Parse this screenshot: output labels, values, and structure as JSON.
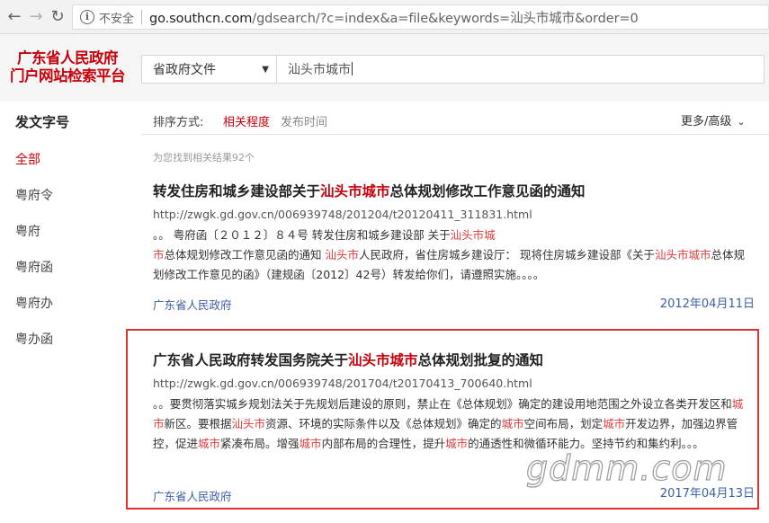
{
  "browser": {
    "security_label": "不安全",
    "url_host": "go.southcn.com",
    "url_rest": "/gdsearch/?c=index&a=file&keywords=汕头市城市&order=0"
  },
  "logo": {
    "line1": "广东省人民政府",
    "line2": "门户网站检索平台"
  },
  "search": {
    "scope": "省政府文件",
    "keyword": "汕头市城市"
  },
  "sidebar": {
    "title": "发文字号",
    "items": [
      {
        "label": "全部",
        "active": true
      },
      {
        "label": "粤府令"
      },
      {
        "label": "粤府"
      },
      {
        "label": "粤府函"
      },
      {
        "label": "粤府办"
      },
      {
        "label": "粤办函"
      }
    ]
  },
  "sort": {
    "label": "排序方式:",
    "options": [
      {
        "label": "相关程度",
        "active": true
      },
      {
        "label": "发布时间"
      }
    ],
    "more": "更多/高级"
  },
  "result_count": "为您找到相关结果92个",
  "results": [
    {
      "title_pre": "转发住房和城乡建设部关于",
      "title_hl": "汕头市城市",
      "title_post": "总体规划修改工作意见函的通知",
      "url": "http://zwgk.gd.gov.cn/006939748/201204/t20120411_311831.html",
      "snippet": [
        {
          "t": "。。                              粤府函〔２０１２〕８４号               转发住房和城乡建设部 关于"
        },
        {
          "t": "汕头市城",
          "hl": true
        },
        {
          "t": "市",
          "hl": true
        },
        {
          "t": "总体规划修改工作意见函的通知       "
        },
        {
          "t": "汕头市",
          "hl": true
        },
        {
          "t": "人民政府，省住房城乡建设厅：       现将住房城乡建设部《关于"
        },
        {
          "t": "汕头市城市",
          "hl": true
        },
        {
          "t": "总体规划修改工作意见的函》（建规函〔2012〕42号）转发给你们，请遵照实施。。。。"
        }
      ],
      "source": "广东省人民政府",
      "date": "2012年04月11日"
    },
    {
      "title_pre": "广东省人民政府转发国务院关于",
      "title_hl": "汕头市城市",
      "title_post": "总体规划批复的通知",
      "url": "http://zwgk.gd.gov.cn/006939748/201704/t20170413_700640.html",
      "snippet": [
        {
          "t": "。。要贯彻落实城乡规划法关于先规划后建设的原则，禁止在《总体规划》确定的建设用地范围之外设立各类开发区和"
        },
        {
          "t": "城市",
          "hl": true
        },
        {
          "t": "新区。要根据"
        },
        {
          "t": "汕头市",
          "hl": true
        },
        {
          "t": "资源、环境的实际条件以及《总体规划》确定的"
        },
        {
          "t": "城市",
          "hl": true
        },
        {
          "t": "空间布局，划定"
        },
        {
          "t": "城市",
          "hl": true
        },
        {
          "t": "开发边界，加强边界管控，促进"
        },
        {
          "t": "城市",
          "hl": true
        },
        {
          "t": "紧凑布局。增强"
        },
        {
          "t": "城市",
          "hl": true
        },
        {
          "t": "内部布局的合理性，提升"
        },
        {
          "t": "城市",
          "hl": true
        },
        {
          "t": "的通透性和微循环能力。坚持节约和集约利。。。"
        }
      ],
      "source": "广东省人民政府",
      "date": "2017年04月13日"
    }
  ],
  "watermark": "gdmm.com",
  "colors": {
    "brand_red": "#c7000b",
    "highlight_red": "#e03a3a",
    "link_blue": "#3a5ea5",
    "box_red": "#e03131"
  },
  "icons": [
    "back-arrow-icon",
    "forward-arrow-icon",
    "reload-icon",
    "info-icon",
    "dropdown-caret-icon",
    "chevron-down-icon"
  ]
}
